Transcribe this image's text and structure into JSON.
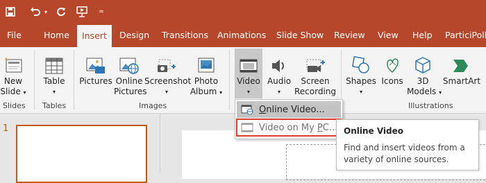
{
  "quick_access": {
    "icons": [
      "save-icon",
      "undo-icon",
      "redo-icon",
      "start-from-beginning-icon",
      "customize-qat-icon"
    ]
  },
  "tabs": [
    "File",
    "Home",
    "Insert",
    "Design",
    "Transitions",
    "Animations",
    "Slide Show",
    "Review",
    "View",
    "Help",
    "ParticiPoll"
  ],
  "active_tab": "Insert",
  "ribbon": {
    "new_slide": {
      "line1": "New",
      "line2": "Slide"
    },
    "table": {
      "line1": "Table"
    },
    "pictures": {
      "line1": "Pictures"
    },
    "online_pictures": {
      "line1": "Online",
      "line2": "Pictures"
    },
    "screenshot": {
      "line1": "Screenshot"
    },
    "photo_album": {
      "line1": "Photo",
      "line2": "Album"
    },
    "video": {
      "line1": "Video"
    },
    "audio": {
      "line1": "Audio"
    },
    "screen_recording": {
      "line1": "Screen",
      "line2": "Recording"
    },
    "shapes": {
      "line1": "Shapes"
    },
    "icons": {
      "line1": "Icons"
    },
    "models_3d": {
      "line1": "3D",
      "line2": "Models"
    },
    "smartart": {
      "line1": "SmartArt"
    },
    "groups": {
      "slides": "Slides",
      "tables": "Tables",
      "images": "Images",
      "illustrations": "Illustrations"
    }
  },
  "video_menu": {
    "online_video": {
      "prefix": "",
      "accel": "O",
      "rest": "nline Video..."
    },
    "video_on_pc": {
      "prefix": "Video on My ",
      "accel": "P",
      "rest": "C..."
    }
  },
  "tooltip": {
    "title": "Online Video",
    "body": "Find and insert videos from a variety of online sources."
  },
  "slide_panel": {
    "number": "1"
  },
  "colors": {
    "accent": "#b7472a",
    "highlight_border": "#e03c31",
    "slide_border": "#c55a11"
  }
}
